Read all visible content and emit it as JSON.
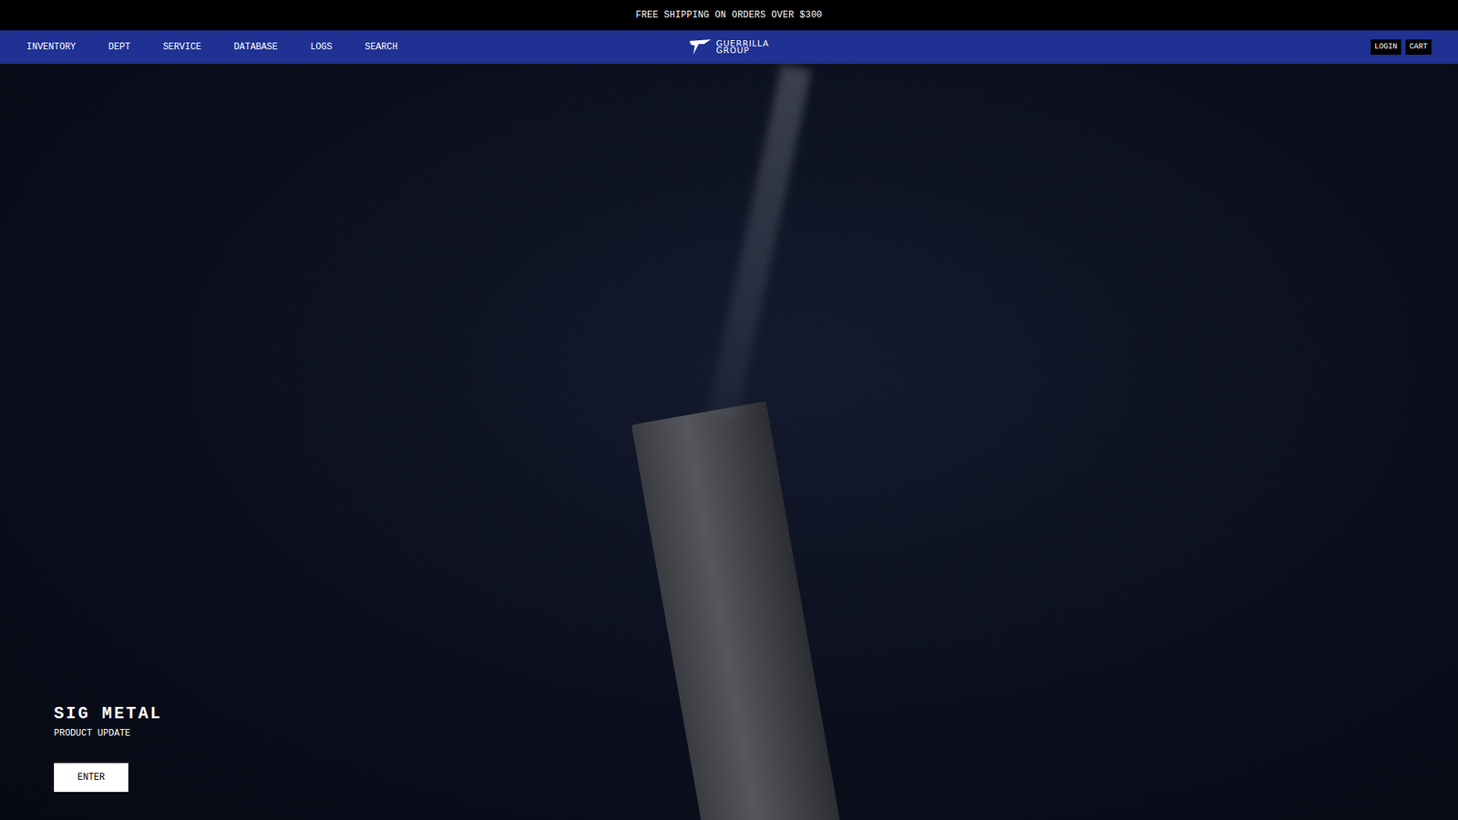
{
  "announcement": "FREE SHIPPING ON ORDERS OVER $300",
  "nav": {
    "links": [
      "INVENTORY",
      "DEPT",
      "SERVICE",
      "DATABASE",
      "LOGS",
      "SEARCH"
    ],
    "logo": {
      "line1": "GUERRILLA",
      "line2": "GROUP"
    },
    "actions": [
      "LOGIN",
      "CART"
    ]
  },
  "hero": {
    "title": "SIG METAL",
    "subtitle": "PRODUCT UPDATE",
    "button": "ENTER"
  }
}
